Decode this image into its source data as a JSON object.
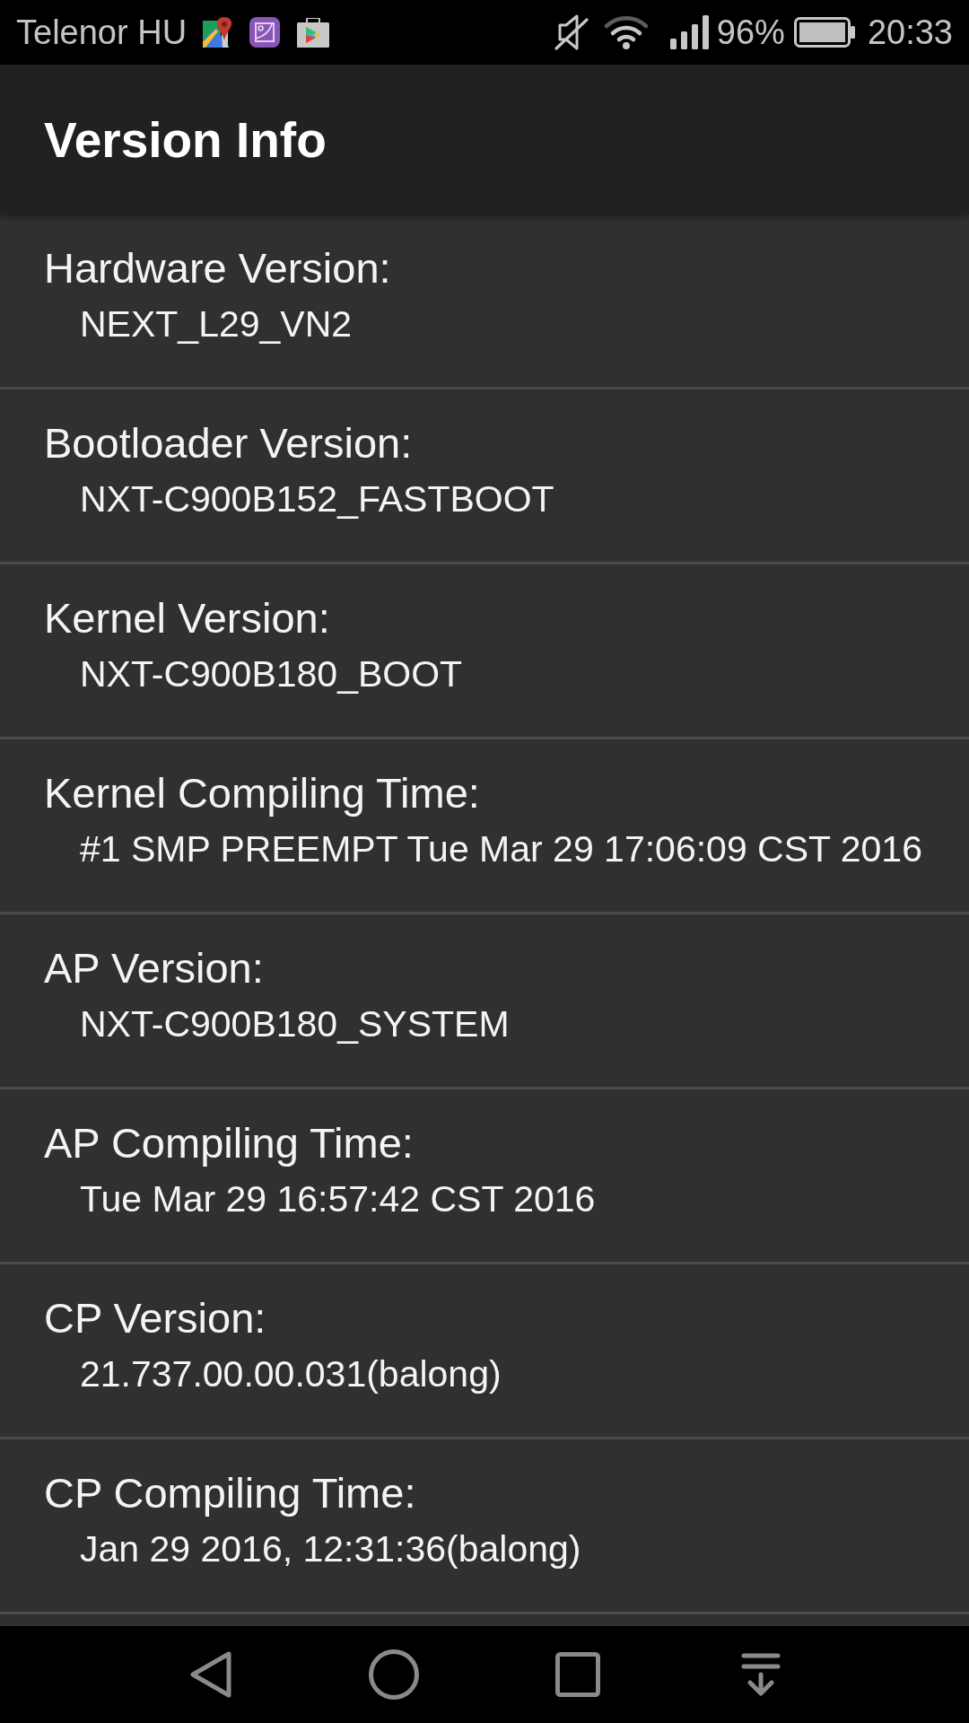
{
  "status_bar": {
    "carrier": "Telenor HU",
    "battery_percent": "96%",
    "time": "20:33"
  },
  "app_bar": {
    "title": "Version Info"
  },
  "items": [
    {
      "label": "Hardware Version:",
      "value": "NEXT_L29_VN2"
    },
    {
      "label": "Bootloader Version:",
      "value": "NXT-C900B152_FASTBOOT"
    },
    {
      "label": "Kernel Version:",
      "value": "NXT-C900B180_BOOT"
    },
    {
      "label": "Kernel Compiling Time:",
      "value": "#1 SMP PREEMPT Tue Mar 29 17:06:09 CST 2016"
    },
    {
      "label": "AP Version:",
      "value": "NXT-C900B180_SYSTEM"
    },
    {
      "label": "AP Compiling Time:",
      "value": "Tue Mar 29 16:57:42 CST 2016"
    },
    {
      "label": "CP Version:",
      "value": "21.737.00.00.031(balong)"
    },
    {
      "label": "CP Compiling Time:",
      "value": "Jan 29 2016, 12:31:36(balong)"
    }
  ]
}
